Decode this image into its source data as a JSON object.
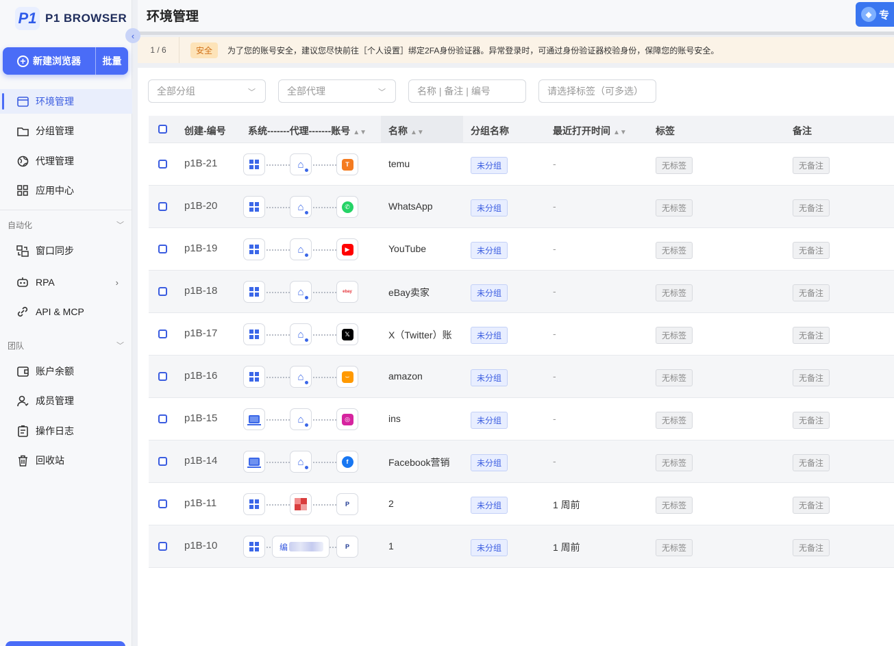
{
  "app": {
    "logo_mark": "P1",
    "logo_text": "P1 BROWSER"
  },
  "sidebar": {
    "new_browser_label": "新建浏览器",
    "batch_label": "批量",
    "items": [
      {
        "label": "环境管理",
        "icon": "window-icon",
        "active": true
      },
      {
        "label": "分组管理",
        "icon": "folder-icon"
      },
      {
        "label": "代理管理",
        "icon": "globe-icon"
      },
      {
        "label": "应用中心",
        "icon": "apps-icon"
      }
    ],
    "section_automation": "自动化",
    "automation_items": [
      {
        "label": "窗口同步",
        "icon": "sync-icon"
      },
      {
        "label": "RPA",
        "icon": "robot-icon"
      },
      {
        "label": "API & MCP",
        "icon": "link-icon"
      }
    ],
    "section_team": "团队",
    "team_items": [
      {
        "label": "账户余额",
        "icon": "wallet-icon"
      },
      {
        "label": "成员管理",
        "icon": "user-icon"
      },
      {
        "label": "操作日志",
        "icon": "log-icon"
      },
      {
        "label": "回收站",
        "icon": "trash-icon"
      }
    ]
  },
  "header": {
    "title": "环境管理",
    "pro_label": "专"
  },
  "notice": {
    "pager": "1 / 6",
    "tag": "安全",
    "message": "为了您的账号安全，建议您尽快前往［个人设置］绑定2FA身份验证器。异常登录时，可通过身份验证器校验身份，保障您的账号安全。"
  },
  "filters": {
    "group": "全部分组",
    "proxy": "全部代理",
    "search": "名称 | 备注 | 编号",
    "tags": "请选择标签（可多选）"
  },
  "table": {
    "headers": {
      "id": "创建-编号",
      "chain": "系统-------代理-------账号",
      "name": "名称",
      "group": "分组名称",
      "last_open": "最近打开时间",
      "tags": "标签",
      "remark": "备注"
    },
    "rows": [
      {
        "id": "p1B-21",
        "os": "windows",
        "app": "temu",
        "name": "temu",
        "group": "未分组",
        "last_open": "-",
        "tags": "无标签",
        "remark": "无备注"
      },
      {
        "id": "p1B-20",
        "os": "windows",
        "app": "whatsapp",
        "name": "WhatsApp",
        "group": "未分组",
        "last_open": "-",
        "tags": "无标签",
        "remark": "无备注"
      },
      {
        "id": "p1B-19",
        "os": "windows",
        "app": "youtube",
        "name": "YouTube",
        "group": "未分组",
        "last_open": "-",
        "tags": "无标签",
        "remark": "无备注"
      },
      {
        "id": "p1B-18",
        "os": "windows",
        "app": "ebay",
        "name": "eBay卖家",
        "group": "未分组",
        "last_open": "-",
        "tags": "无标签",
        "remark": "无备注"
      },
      {
        "id": "p1B-17",
        "os": "windows",
        "app": "x",
        "name": "X（Twitter）账",
        "group": "未分组",
        "last_open": "-",
        "tags": "无标签",
        "remark": "无备注"
      },
      {
        "id": "p1B-16",
        "os": "windows",
        "app": "amazon",
        "name": "amazon",
        "group": "未分组",
        "last_open": "-",
        "tags": "无标签",
        "remark": "无备注"
      },
      {
        "id": "p1B-15",
        "os": "mac",
        "app": "instagram",
        "name": "ins",
        "group": "未分组",
        "last_open": "-",
        "tags": "无标签",
        "remark": "无备注"
      },
      {
        "id": "p1B-14",
        "os": "mac",
        "app": "facebook",
        "name": "Facebook营销",
        "group": "未分组",
        "last_open": "-",
        "tags": "无标签",
        "remark": "无备注"
      },
      {
        "id": "p1B-11",
        "os": "windows",
        "app": "paypal",
        "name": "2",
        "group": "未分组",
        "last_open": "1 周前",
        "tags": "无标签",
        "remark": "无备注"
      },
      {
        "id": "p1B-10",
        "os": "windows",
        "app": "paypal",
        "name": "1",
        "group": "未分组",
        "last_open": "1 周前",
        "tags": "无标签",
        "remark": "无备注",
        "proxy_label": "编"
      }
    ]
  },
  "colors": {
    "accent": "#4a6cf7",
    "notice_bg": "#fbf3e7",
    "tag_orange": "#d0711a"
  }
}
